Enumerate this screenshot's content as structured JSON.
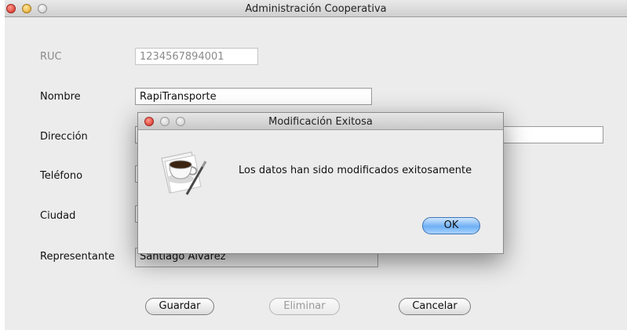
{
  "window": {
    "title": "Administración Cooperativa"
  },
  "form": {
    "ruc": {
      "label": "RUC",
      "value": "1234567894001"
    },
    "nombre": {
      "label": "Nombre",
      "value": "RapiTransporte"
    },
    "direccion": {
      "label": "Dirección",
      "value": ""
    },
    "telefono": {
      "label": "Teléfono",
      "value": ""
    },
    "ciudad": {
      "label": "Ciudad",
      "value": ""
    },
    "representante": {
      "label": "Representante",
      "value": "Santiago Alvarez"
    }
  },
  "buttons": {
    "save": "Guardar",
    "delete": "Eliminar",
    "cancel": "Cancelar"
  },
  "dialog": {
    "title": "Modificación Exitosa",
    "message": "Los datos han sido modificados exitosamente",
    "ok": "OK",
    "icon": "coffee-cup-icon"
  }
}
